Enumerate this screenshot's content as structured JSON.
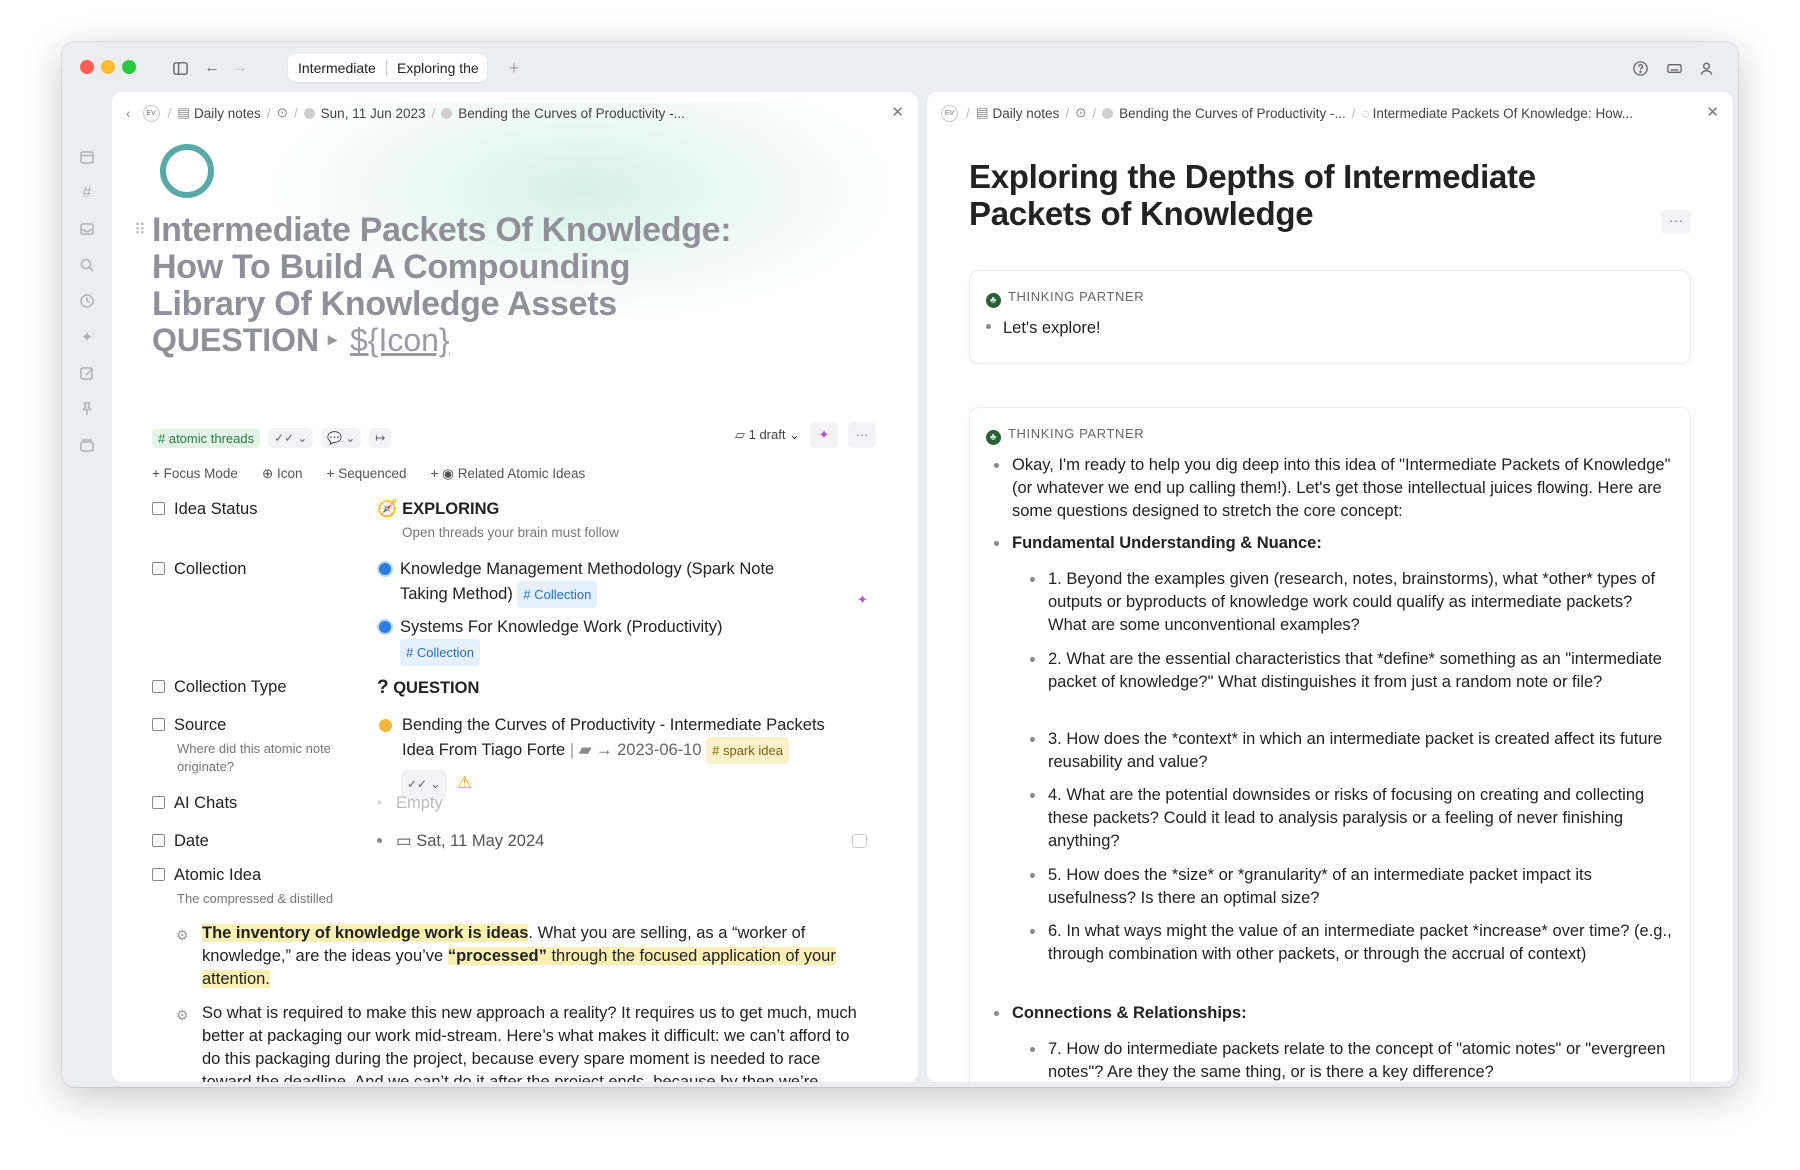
{
  "tabs": [
    "Intermediate",
    "Exploring the"
  ],
  "left": {
    "crumb": {
      "avatar": "EV",
      "daily": "Daily notes",
      "date": "Sun, 11 Jun 2023",
      "note": "Bending the Curves of Productivity -..."
    },
    "title": "Intermediate Packets Of Knowledge: How To Build A Compounding Library Of Knowledge Assets",
    "question_label": "QUESTION",
    "icon_placeholder": "${Icon}",
    "tag": "# atomic threads",
    "draft": "1 draft",
    "add": {
      "focus": "Focus Mode",
      "icon": "Icon",
      "sequenced": "Sequenced",
      "related": "Related Atomic Ideas"
    },
    "props": {
      "idea_status": {
        "label": "Idea Status",
        "value": "EXPLORING",
        "sub": "Open threads your brain must follow"
      },
      "collection": {
        "label": "Collection",
        "v1": "Knowledge Management Methodology (Spark Note Taking Method)",
        "v2": "Systems For Knowledge Work (Productivity)",
        "chip": "# Collection"
      },
      "collection_type": {
        "label": "Collection Type",
        "value": "QUESTION"
      },
      "source": {
        "label": "Source",
        "sub": "Where did this atomic note originate?",
        "value": "Bending the Curves of Productivity - Intermediate Packets Idea From Tiago Forte",
        "date": "2023-06-10",
        "chip": "# spark idea"
      },
      "ai_chats": {
        "label": "AI Chats",
        "value": "Empty"
      },
      "date": {
        "label": "Date",
        "value": "Sat, 11 May 2024"
      },
      "atomic_idea": {
        "label": "Atomic Idea",
        "sub": "The compressed & distilled"
      }
    },
    "p1": {
      "h1": "The inventory of knowledge work is ideas",
      "t1": ". What you are selling, as a “worker of knowledge,” are the ideas you’ve ",
      "h2": "“processed”",
      "h3": " through the focused application of your attention."
    },
    "p2": "So what is required to make this new approach a reality? It requires us to get much, much better at packaging our work mid-stream. Here’s what makes it difficult: we can’t afford to do this packaging during the project, because every spare moment is needed to race toward the deadline. And we can’t do it after the project ends, because by then we’re already off to the next one. No, this packaging has to be"
  },
  "right": {
    "crumb": {
      "avatar": "EV",
      "daily": "Daily notes",
      "note": "Bending the Curves of Productivity -...",
      "note2": "Intermediate Packets Of Knowledge: How..."
    },
    "title": "Exploring the Depths of Intermediate Packets of Knowledge",
    "partner": "THINKING PARTNER",
    "msg1": "Let's explore!",
    "msg2": "Okay, I'm ready to help you dig deep into this idea of \"Intermediate Packets of Knowledge\" (or whatever we end up calling them!). Let's get those intellectual juices flowing. Here are some questions designed to stretch the core concept:",
    "sec1": "Fundamental Understanding & Nuance:",
    "q": [
      "1.  Beyond the examples given (research, notes, brainstorms), what *other* types of outputs or byproducts of knowledge work could qualify as intermediate packets? What are some unconventional examples?",
      "2.  What are the essential characteristics that *define* something as an \"intermediate packet of knowledge?\" What distinguishes it from just a random note or file?",
      "3.  How does the *context* in which an intermediate packet is created affect its future reusability and value?",
      "4.  What are the potential downsides or risks of focusing on creating and collecting these packets? Could it lead to analysis paralysis or a feeling of never finishing anything?",
      "5.  How does the *size* or *granularity* of an intermediate packet impact its usefulness? Is there an optimal size?",
      "6.  In what ways might the value of an intermediate packet *increase* over time? (e.g., through combination with other packets, or through the accrual of context)"
    ],
    "sec2": "Connections & Relationships:",
    "q7": "7.  How do intermediate packets relate to the concept of \"atomic notes\" or \"evergreen notes\"? Are they the same thing, or is there a key difference?"
  }
}
